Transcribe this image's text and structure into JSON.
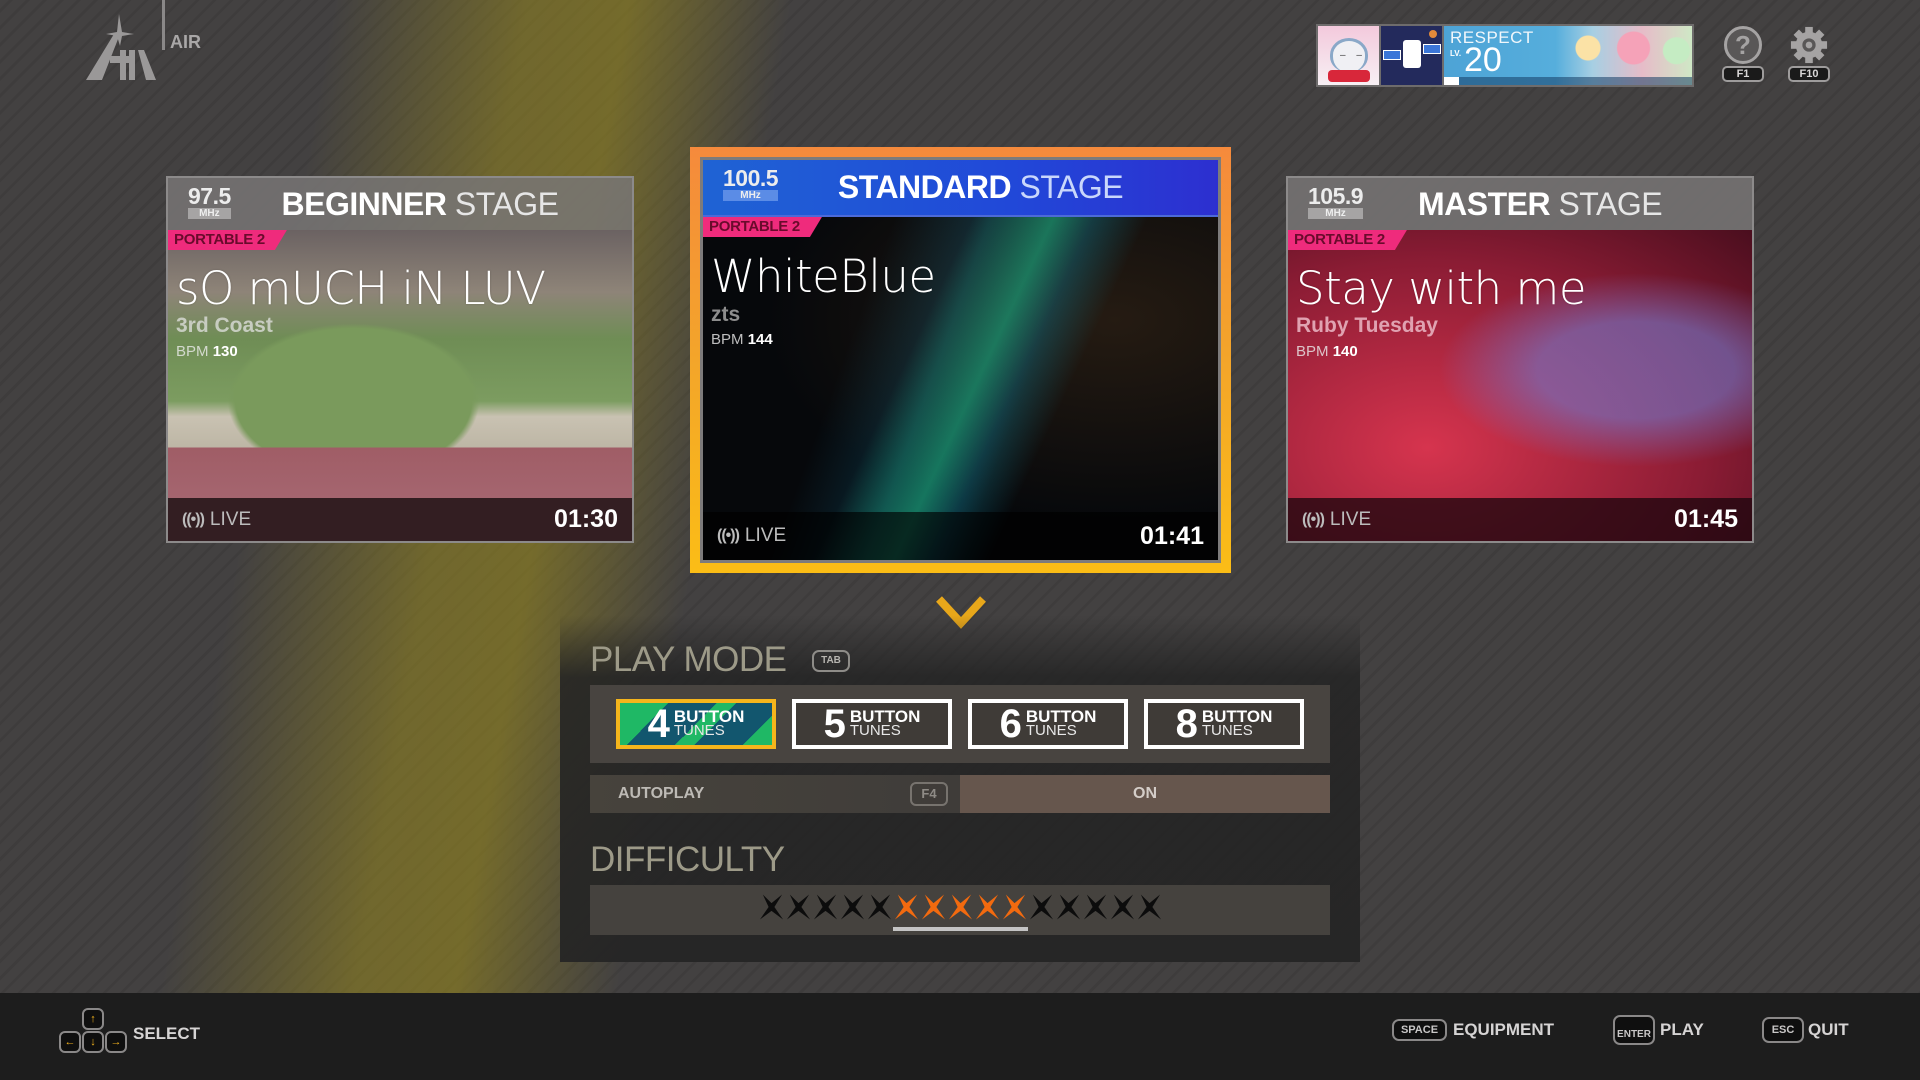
{
  "header": {
    "logo_label": "AIR",
    "profile": {
      "respect_label": "RESPECT",
      "level_prefix": "LV.",
      "level": "20",
      "level_progress": 0.06
    },
    "help_key": "F1",
    "settings_key": "F10"
  },
  "stages": [
    {
      "frequency": "97.5",
      "frequency_unit": "MHz",
      "difficulty_word": "BEGINNER",
      "stage_word": "STAGE",
      "tag": "PORTABLE 2",
      "title": "sO mUCH iN LUV",
      "artist": "3rd Coast",
      "bpm_label": "BPM",
      "bpm": "130",
      "live_label": "LIVE",
      "duration": "01:30"
    },
    {
      "frequency": "100.5",
      "frequency_unit": "MHz",
      "difficulty_word": "STANDARD",
      "stage_word": "STAGE",
      "tag": "PORTABLE 2",
      "title": "WhiteBlue",
      "artist": "zts",
      "bpm_label": "BPM",
      "bpm": "144",
      "live_label": "LIVE",
      "duration": "01:41",
      "selected": true
    },
    {
      "frequency": "105.9",
      "frequency_unit": "MHz",
      "difficulty_word": "MASTER",
      "stage_word": "STAGE",
      "tag": "PORTABLE 2",
      "title": "Stay with me",
      "artist": "Ruby Tuesday",
      "bpm_label": "BPM",
      "bpm": "140",
      "live_label": "LIVE",
      "duration": "01:45"
    }
  ],
  "play_mode": {
    "title": "PLAY MODE",
    "key": "TAB",
    "modes": [
      {
        "number": "4",
        "line1": "BUTTON",
        "line2": "TUNES",
        "selected": true
      },
      {
        "number": "5",
        "line1": "BUTTON",
        "line2": "TUNES",
        "selected": false
      },
      {
        "number": "6",
        "line1": "BUTTON",
        "line2": "TUNES",
        "selected": false
      },
      {
        "number": "8",
        "line1": "BUTTON",
        "line2": "TUNES",
        "selected": false
      }
    ],
    "autoplay_label": "AUTOPLAY",
    "autoplay_key": "F4",
    "autoplay_value": "ON"
  },
  "difficulty": {
    "title": "DIFFICULTY",
    "total_stars": 15,
    "lit_start": 6,
    "lit_end": 10,
    "lit_color": "#f26a0f",
    "unlit_color": "#0c0c0c"
  },
  "footer": {
    "select_label": "SELECT",
    "arrow_keys": {
      "up": "↑",
      "left": "←",
      "down": "↓",
      "right": "→"
    },
    "equipment_key": "SPACE",
    "equipment_label": "EQUIPMENT",
    "play_key": "ENTER",
    "play_label": "PLAY",
    "quit_key": "ESC",
    "quit_label": "QUIT"
  },
  "colors": {
    "selection_border": "#f5b51c",
    "portable_tag": "#ef2b7c",
    "standard_header": "#2148d8"
  }
}
